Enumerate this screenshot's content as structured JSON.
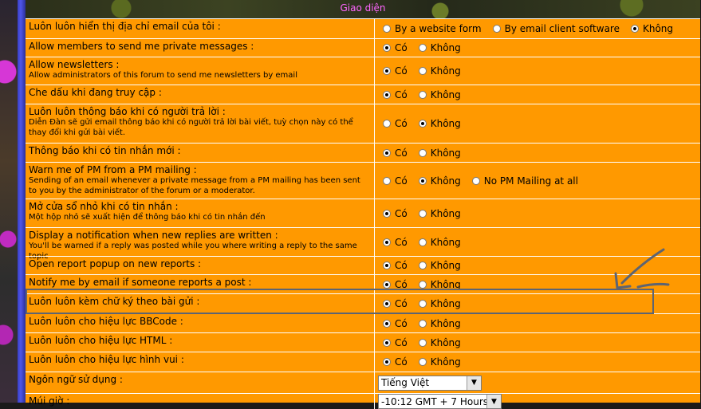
{
  "header": {
    "title": "Giao diện"
  },
  "rows": [
    {
      "label": "Luôn luôn hiển thị địa chỉ email của tôi :",
      "options": [
        "By a website form",
        "By email client software",
        "Không"
      ],
      "selected": 2
    },
    {
      "label": "Allow members to send me private messages :",
      "options": [
        "Có",
        "Không"
      ],
      "selected": 0
    },
    {
      "label": "Allow newsletters :",
      "sub": "Allow administrators of this forum to send me newsletters by email",
      "options": [
        "Có",
        "Không"
      ],
      "selected": 0
    },
    {
      "label": "Che dấu khi đang truy cập :",
      "options": [
        "Có",
        "Không"
      ],
      "selected": 0
    },
    {
      "label": "Luôn luôn thông báo khi có người trả lời :",
      "sub": "Diễn Đàn sẽ gửi email thông báo khi có người trả lời bài viết, tuỳ chọn này có thể thay đổi khi gửi bài viết.",
      "options": [
        "Có",
        "Không"
      ],
      "selected": 1
    },
    {
      "label": "Thông báo khi có tin nhắn mới :",
      "options": [
        "Có",
        "Không"
      ],
      "selected": 0
    },
    {
      "label": "Warn me of PM from a PM mailing :",
      "sub": "Sending of an email whenever a private message from a PM mailing has been sent to you by the administrator of the forum or a moderator.",
      "options": [
        "Có",
        "Không",
        "No PM Mailing at all"
      ],
      "selected": 1
    },
    {
      "label": "Mở cửa sổ nhỏ khi có tin nhắn :",
      "sub": "Một hộp nhỏ sẽ xuất hiện để thông báo khi có tin nhắn đến",
      "options": [
        "Có",
        "Không"
      ],
      "selected": 0
    },
    {
      "label": "Display a notification when new replies are written :",
      "sub": "You'll be warned if a reply was posted while you where writing a reply to the same topic",
      "options": [
        "Có",
        "Không"
      ],
      "selected": 0
    },
    {
      "label": "Open report popup on new reports :",
      "options": [
        "Có",
        "Không"
      ],
      "selected": 0
    },
    {
      "label": "Notify me by email if someone reports a post :",
      "options": [
        "Có",
        "Không"
      ],
      "selected": 0
    },
    {
      "label": "Luôn luôn kèm chữ ký theo bài gửi :",
      "options": [
        "Có",
        "Không"
      ],
      "selected": 0
    },
    {
      "label": "Luôn luôn cho hiệu lực BBCode :",
      "options": [
        "Có",
        "Không"
      ],
      "selected": 0
    },
    {
      "label": "Luôn luôn cho hiệu lực HTML :",
      "options": [
        "Có",
        "Không"
      ],
      "selected": 0
    },
    {
      "label": "Luôn luôn cho hiệu lực hình vui :",
      "options": [
        "Có",
        "Không"
      ],
      "selected": 0
    },
    {
      "label": "Ngôn ngữ sử dụng :",
      "select": "Tiếng Việt"
    },
    {
      "label": "Múi giờ :",
      "select": "-10:12 GMT + 7 Hours"
    }
  ],
  "icons": {
    "select_arrow": "chevron-down-icon",
    "annotation": "hand-drawn-arrow-icon"
  },
  "colors": {
    "panel": "#ff9900",
    "header_text": "#ff66ff",
    "annotation": "#5d6472"
  }
}
